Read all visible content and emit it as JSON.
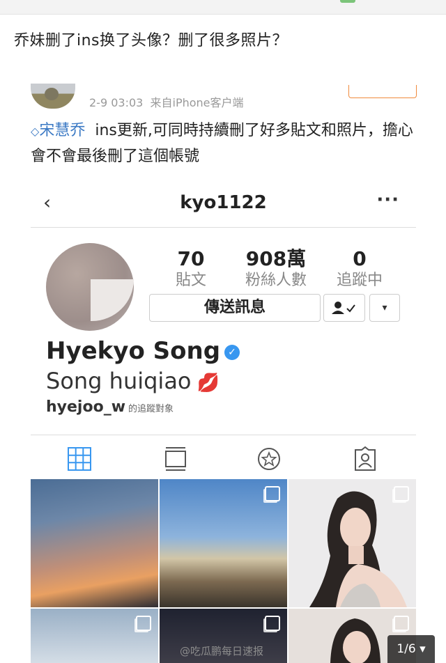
{
  "post": {
    "title": "乔妹删了ins换了头像？删了很多照片？"
  },
  "weibo": {
    "timestamp": "2-9 03:03",
    "source": "来自iPhone客户端",
    "mention": "宋慧乔",
    "body": "ins更新,可同時持續刪了好多貼文和照片，擔心會不會最後刪了這個帳號"
  },
  "instagram": {
    "back_icon": "‹",
    "username": "kyo1122",
    "more_icon": "···",
    "stats": [
      {
        "value": "70",
        "label": "貼文"
      },
      {
        "value": "908萬",
        "label": "粉絲人數"
      },
      {
        "value": "0",
        "label": "追蹤中"
      }
    ],
    "message_button": "傳送訊息",
    "follow_icon": "person-check-icon",
    "dropdown_icon": "▾",
    "full_name": "Hyekyo Song",
    "verified_mark": "✓",
    "alias": "Song huiqiao",
    "lips_emoji": "💋",
    "followed_by": "hyejoo_w",
    "followed_by_suffix": "的追蹤對象"
  },
  "footer": {
    "watermark": "@吃瓜鹏每日速报",
    "pager": "1/6 ▾"
  },
  "colors": {
    "mention": "#3b79c4",
    "verified": "#3897f0",
    "active_tab": "#3897f0",
    "follow_outline": "#f08a3c"
  }
}
